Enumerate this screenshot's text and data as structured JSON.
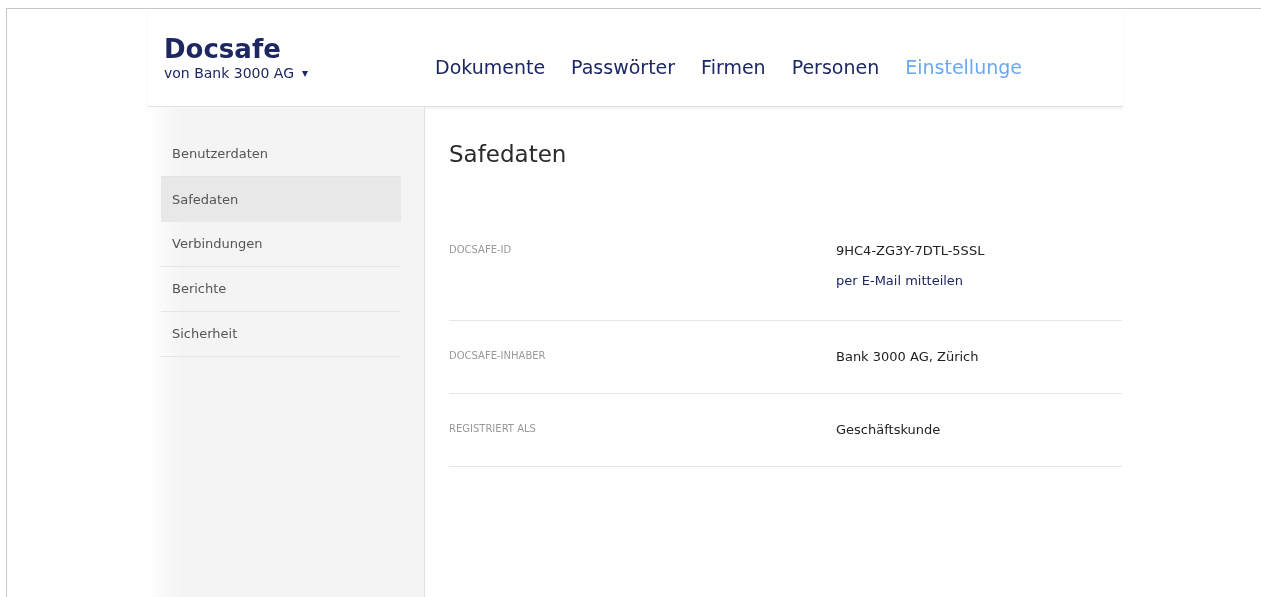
{
  "brand": {
    "title": "Docsafe",
    "subtitle": "von Bank 3000 AG",
    "caret": "▾"
  },
  "nav": [
    {
      "label": "Dokumente",
      "selected": false
    },
    {
      "label": "Passwörter",
      "selected": false
    },
    {
      "label": "Firmen",
      "selected": false
    },
    {
      "label": "Personen",
      "selected": false
    },
    {
      "label": "Einstellunge",
      "selected": true
    }
  ],
  "sidebar": {
    "items": [
      {
        "label": "Benutzerdaten",
        "selected": false
      },
      {
        "label": "Safedaten",
        "selected": true
      },
      {
        "label": "Verbindungen",
        "selected": false
      },
      {
        "label": "Berichte",
        "selected": false
      },
      {
        "label": "Sicherheit",
        "selected": false
      }
    ]
  },
  "page_title": "Safedaten",
  "fields": [
    {
      "label": "DOCSAFE-ID",
      "value": "9HC4-ZG3Y-7DTL-5SSL",
      "link": "per E-Mail mitteilen"
    },
    {
      "label": "DOCSAFE-INHABER",
      "value": "Bank 3000 AG, Zürich"
    },
    {
      "label": "REGISTRIERT ALS",
      "value": "Geschäftskunde"
    }
  ]
}
